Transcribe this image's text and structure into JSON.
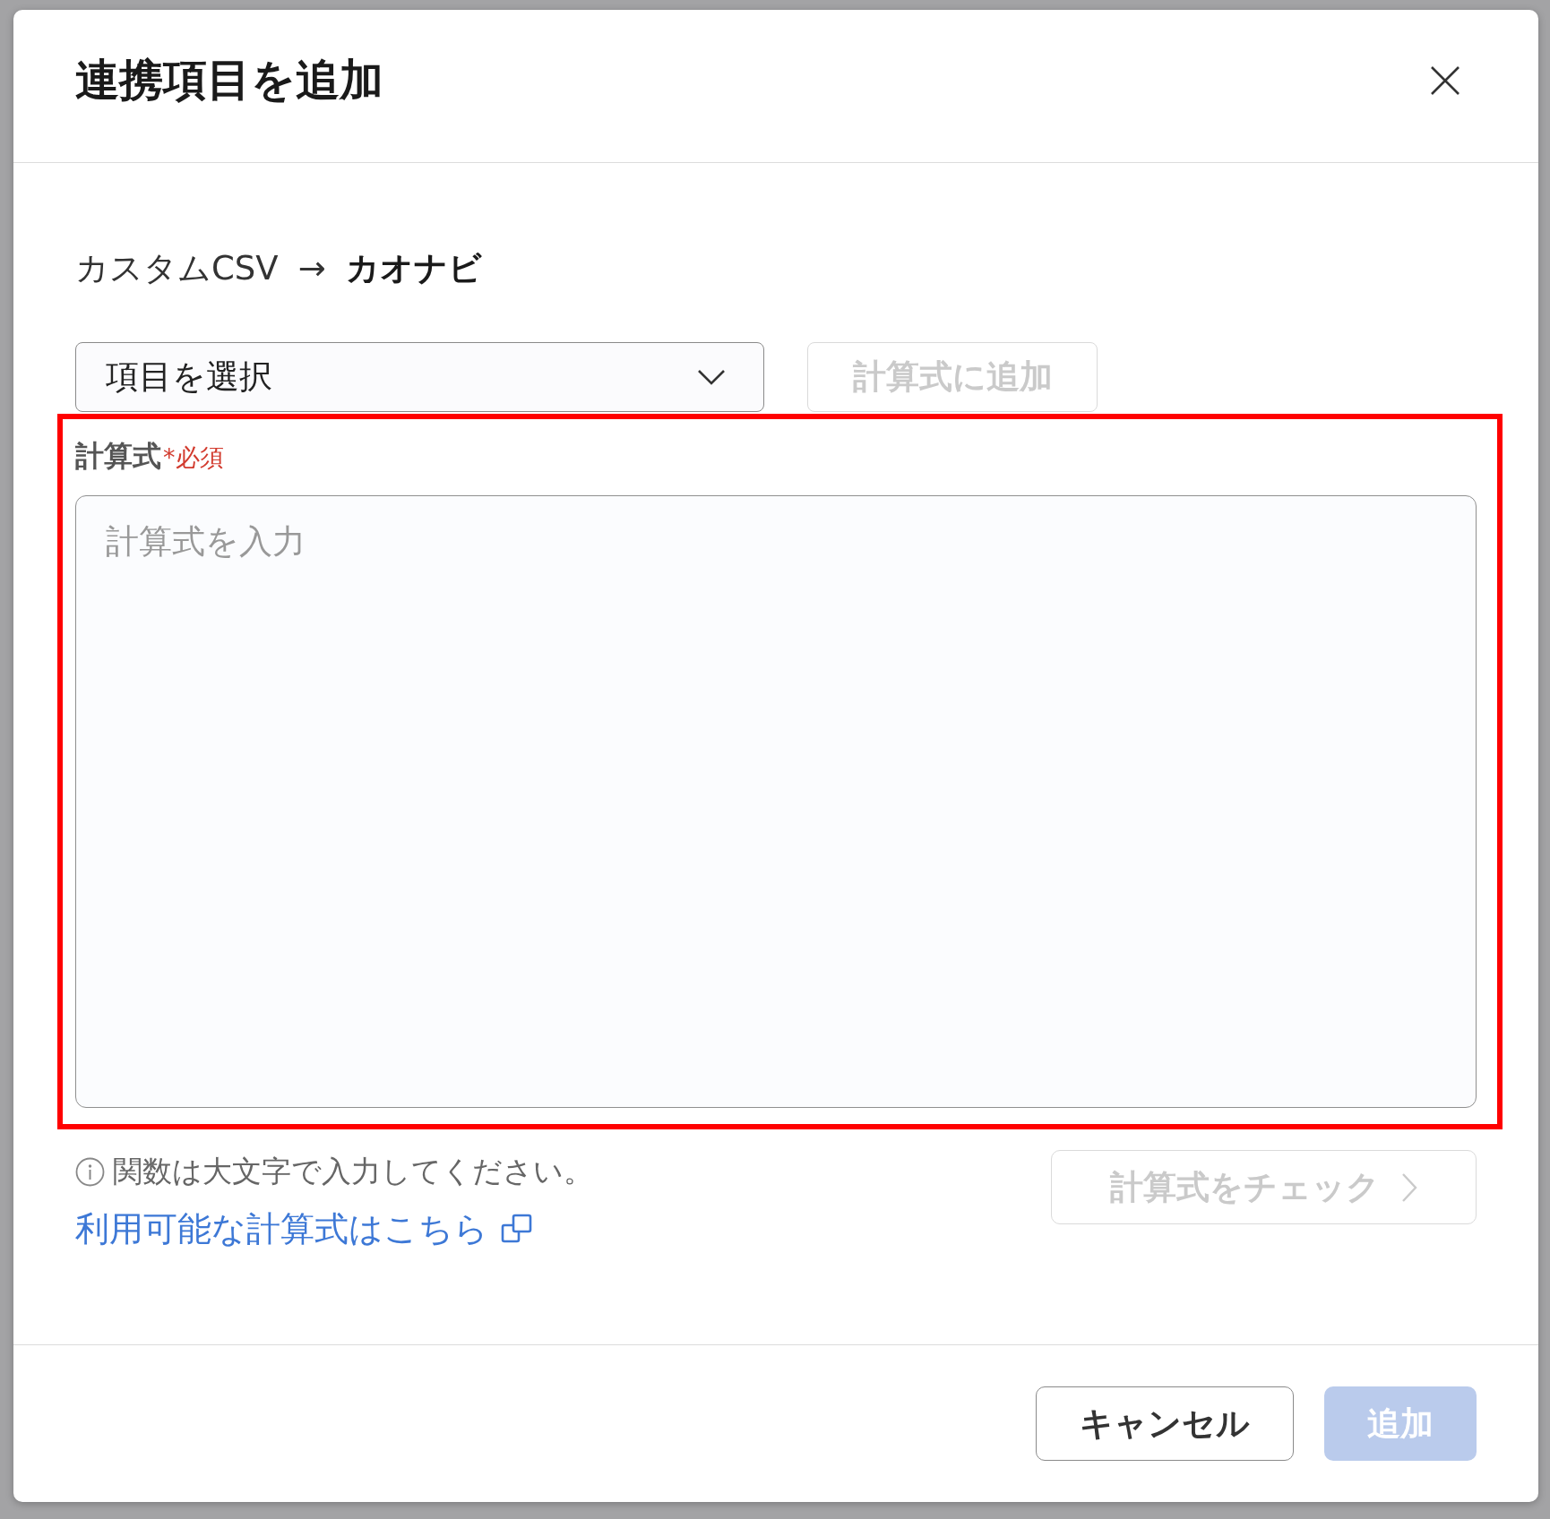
{
  "dialog": {
    "title": "連携項目を追加"
  },
  "mapping": {
    "source": "カスタムCSV",
    "arrow": "→",
    "target": "カオナビ"
  },
  "item_select": {
    "label": "項目を選択"
  },
  "add_to_formula_button": {
    "label": "計算式に追加",
    "disabled": true
  },
  "formula_field": {
    "label": "計算式",
    "required_note": "*必須",
    "placeholder": "計算式を入力",
    "highlighted": true
  },
  "hint": "関数は大文字で入力してください。",
  "functions_link": {
    "label": "利用可能な計算式はこちら"
  },
  "check_button": {
    "label": "計算式をチェック",
    "disabled": true
  },
  "footer": {
    "buttons": [
      {
        "label": "キャンセル",
        "kind": "secondary",
        "disabled": false
      },
      {
        "label": "追加",
        "kind": "primary",
        "disabled": true
      }
    ]
  }
}
